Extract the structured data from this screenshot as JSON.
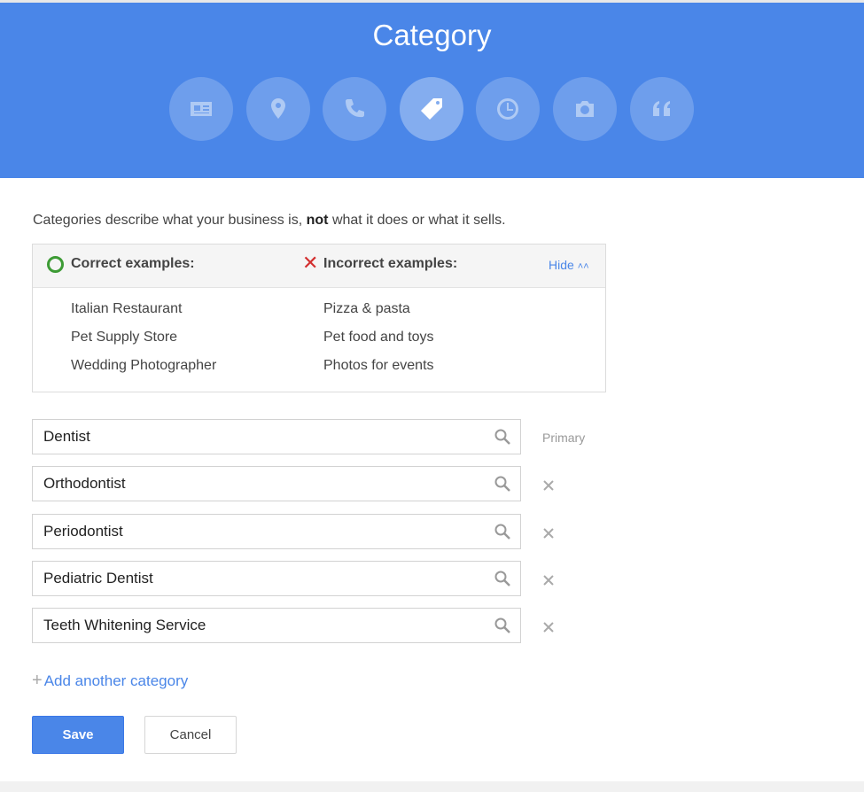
{
  "header": {
    "title": "Category",
    "steps": [
      {
        "icon": "contact-card-icon",
        "active": false
      },
      {
        "icon": "location-pin-icon",
        "active": false
      },
      {
        "icon": "phone-icon",
        "active": false
      },
      {
        "icon": "tag-icon",
        "active": true
      },
      {
        "icon": "clock-icon",
        "active": false
      },
      {
        "icon": "camera-icon",
        "active": false
      },
      {
        "icon": "quote-icon",
        "active": false
      }
    ]
  },
  "intro": {
    "before": "Categories describe what your business is,",
    "emphasis": "not",
    "after": "what it does or what it sells."
  },
  "examples": {
    "correct_title": "Correct examples:",
    "incorrect_title": "Incorrect examples:",
    "hide_label": "Hide",
    "correct": [
      "Italian Restaurant",
      "Pet Supply Store",
      "Wedding Photographer"
    ],
    "incorrect": [
      "Pizza & pasta",
      "Pet food and toys",
      "Photos for events"
    ]
  },
  "categories": [
    {
      "value": "Dentist",
      "primary": true
    },
    {
      "value": "Orthodontist",
      "primary": false
    },
    {
      "value": "Periodontist",
      "primary": false
    },
    {
      "value": "Pediatric Dentist",
      "primary": false
    },
    {
      "value": "Teeth Whitening Service",
      "primary": false
    }
  ],
  "primary_label": "Primary",
  "add_category_label": "Add another category",
  "buttons": {
    "save": "Save",
    "cancel": "Cancel"
  },
  "colors": {
    "brand": "#4a86e8",
    "correct": "#3d9b35",
    "incorrect": "#d32f2f"
  }
}
